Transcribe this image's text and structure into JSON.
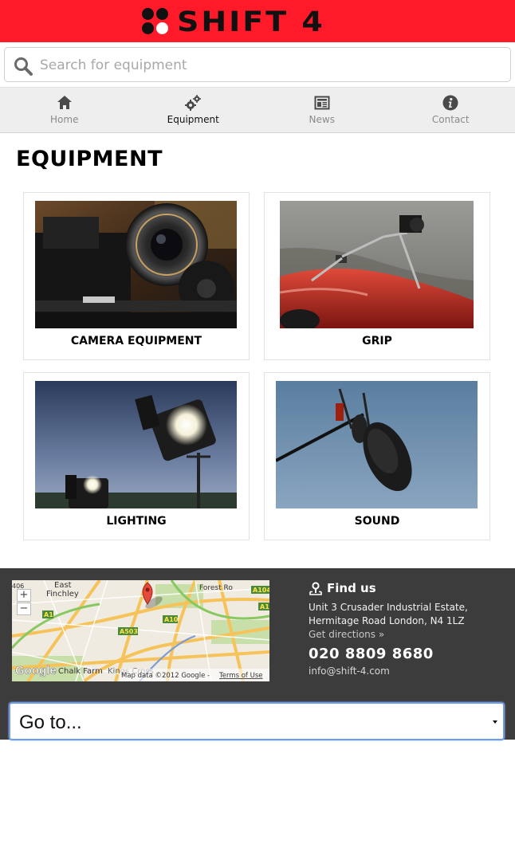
{
  "header": {
    "logo_text": "SHIFT 4",
    "brand_color": "#ff1a2a"
  },
  "search": {
    "placeholder": "Search for equipment",
    "value": ""
  },
  "nav": {
    "items": [
      {
        "label": "Home",
        "icon": "home-icon",
        "active": false
      },
      {
        "label": "Equipment",
        "icon": "gears-icon",
        "active": true
      },
      {
        "label": "News",
        "icon": "newspaper-icon",
        "active": false
      },
      {
        "label": "Contact",
        "icon": "info-icon",
        "active": false
      }
    ]
  },
  "main": {
    "title": "EQUIPMENT",
    "categories": [
      {
        "label": "CAMERA EQUIPMENT",
        "image": "camera-photo"
      },
      {
        "label": "GRIP",
        "image": "grip-photo"
      },
      {
        "label": "LIGHTING",
        "image": "lighting-photo"
      },
      {
        "label": "SOUND",
        "image": "sound-photo"
      }
    ]
  },
  "footer": {
    "map": {
      "labels": {
        "east_finchley": "East",
        "east_finchley_2": "Finchley",
        "chalk_farm": "Chalk Farm",
        "kings_cross": "Kings Cross",
        "forest_road": "Forest Ro",
        "a1": "A1",
        "a10": "A10",
        "a503": "A503",
        "a104": "A104",
        "a1_right": "A1",
        "a406": "406",
        "google": "Google",
        "attribution": "Map data ©2012 Google - ",
        "terms": "Terms of Use"
      },
      "zoom_in": "+",
      "zoom_out": "−"
    },
    "find_us_title": "Find us",
    "address_line1": "Unit 3 Crusader Industrial Estate,",
    "address_line2": "Hermitage Road London, N4 1LZ",
    "directions": "Get directions »",
    "phone": "020 8809 8680",
    "email": "info@shift-4.com",
    "goto": "Go to..."
  }
}
